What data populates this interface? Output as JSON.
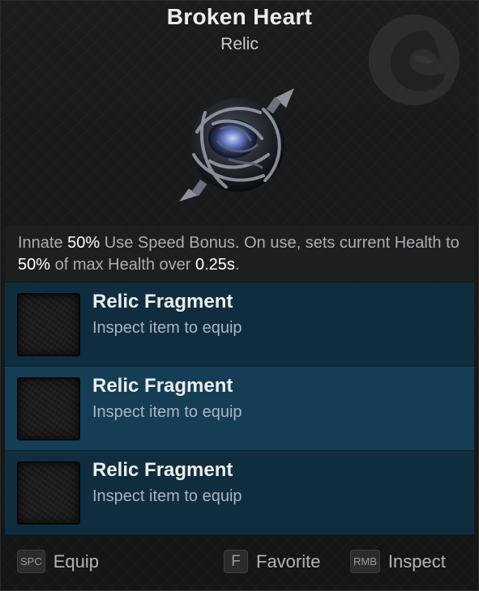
{
  "item": {
    "name": "Broken Heart",
    "category": "Relic",
    "icon": "relic-category-icon",
    "art": "broken-heart-relic-image"
  },
  "description": {
    "t1": "Innate ",
    "v1": "50%",
    "t2": " Use Speed Bonus. On use, sets current Health to ",
    "v2": "50%",
    "t3": " of max Health over ",
    "v3": "0.25s",
    "t4": "."
  },
  "slots": [
    {
      "title": "Relic Fragment",
      "subtitle": "Inspect item to equip",
      "icon": "relic-fragment-slot-icon"
    },
    {
      "title": "Relic Fragment",
      "subtitle": "Inspect item to equip",
      "icon": "relic-fragment-slot-icon"
    },
    {
      "title": "Relic Fragment",
      "subtitle": "Inspect item to equip",
      "icon": "relic-fragment-slot-icon"
    }
  ],
  "actions": {
    "equip": {
      "key": "SPC",
      "label": "Equip"
    },
    "favorite": {
      "key": "F",
      "label": "Favorite"
    },
    "inspect": {
      "key": "RMB",
      "label": "Inspect"
    }
  },
  "colors": {
    "panel": "#171819",
    "slot_dark": "#0f2d3e",
    "slot_highlight": "#153d55",
    "highlight_text": "#ffffff",
    "muted_text": "#a9aeb2"
  }
}
